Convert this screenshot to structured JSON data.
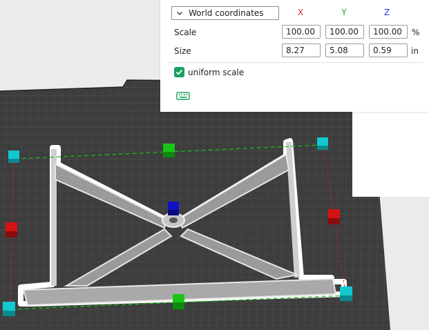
{
  "panel": {
    "coordinate_system": "World coordinates",
    "axes": {
      "x": "X",
      "y": "Y",
      "z": "Z"
    },
    "axis_colors": {
      "x": "#e0282f",
      "y": "#1aa134",
      "z": "#2f2fe0"
    },
    "scale": {
      "label": "Scale",
      "x": "100.00",
      "y": "100.00",
      "z": "100.00",
      "unit": "%"
    },
    "size": {
      "label": "Size",
      "x": "8.27",
      "y": "5.08",
      "z": "0.59",
      "unit": "in"
    },
    "uniform_scale": {
      "label": "uniform scale",
      "checked": true
    },
    "accent_color": "#1aa160"
  },
  "icons": {
    "dropdown": "chevron-down-icon",
    "checkbox": "checkmark-icon",
    "keyboard": "keyboard-icon"
  },
  "scene": {
    "handle_colors": {
      "corner": "#12c9cf",
      "x_axis": "#d41414",
      "y_axis": "#18c418",
      "z_axis": "#1010c8"
    }
  }
}
